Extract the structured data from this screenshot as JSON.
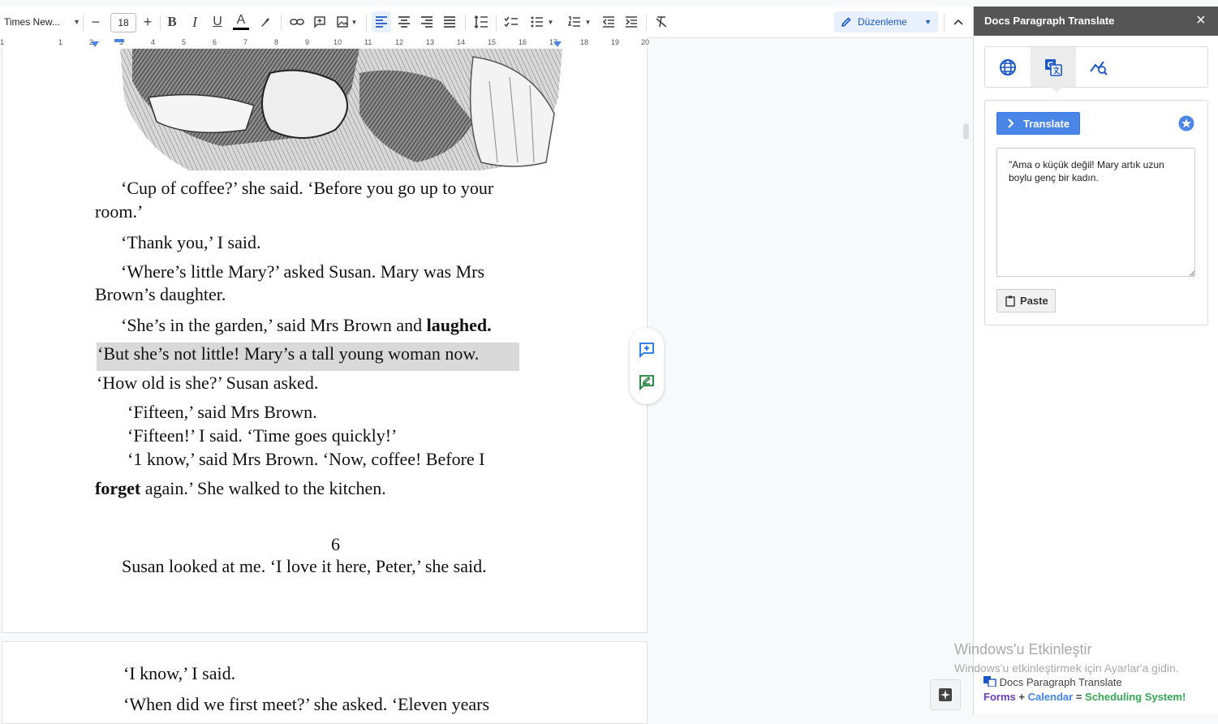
{
  "toolbar": {
    "font_name": "Times New...",
    "font_size": "18",
    "mode_label": "Düzenleme",
    "minus": "−",
    "plus": "+",
    "bold": "B",
    "italic": "I",
    "underline": "U",
    "text_color_letter": "A"
  },
  "ruler": {
    "labels": [
      "1",
      "1",
      "2",
      "3",
      "4",
      "5",
      "6",
      "7",
      "8",
      "9",
      "10",
      "11",
      "12",
      "13",
      "14",
      "15",
      "16",
      "17",
      "18",
      "19",
      "20"
    ]
  },
  "document": {
    "page1": [
      {
        "indent": "‘Cup of coffee?’ she said. ‘Before you go up to your",
        "rest": ""
      },
      "room.’",
      "‘Thank you,’ I said.",
      "‘Where’s little Mary?’ asked Susan. Mary was Mrs",
      "Brown’s daughter.",
      "‘She’s in the garden,’ said Mrs Brown and ",
      "laughed.",
      "‘But she’s not little! Mary’s a tall young woman now.",
      "‘How old is she?’ Susan asked.",
      "‘Fifteen,’ said Mrs Brown.",
      "‘Fifteen!’ I said. ‘Time goes quickly!’",
      "‘1 know,’ said Mrs Brown. ‘Now, coffee! Before I",
      "forget",
      " again.’ She walked to the kitchen.",
      "6",
      "Susan looked at me. ‘I love it here, Peter,’ she said."
    ],
    "page2": [
      "‘I know,’ I said.",
      "‘When did we first meet?’ she asked. ‘Eleven years"
    ]
  },
  "sidebar": {
    "title": "Docs Paragraph Translate",
    "close": "×",
    "tabs": [
      "globe-icon",
      "translate-icon",
      "analytics-icon"
    ],
    "translate_label": "Translate",
    "result_text": "\"Ama o küçük değil! Mary artık uzun boylu genç bir kadın.",
    "paste_label": "Paste",
    "promo": {
      "brand": "Docs Paragraph Translate",
      "forms": "Forms",
      "plus": " + ",
      "calendar": "Calendar",
      "equals": " = ",
      "system": "Scheduling System",
      "bang": "!"
    }
  },
  "watermark": {
    "title": "Windows'u Etkinleştir",
    "subtitle": "Windows'u etkinleştirmek için Ayarlar'a gidin."
  },
  "colors": {
    "accent": "#4a86e8",
    "header": "#555555",
    "mode_bg": "#e8f0fe",
    "highlight": "#d9d9d9",
    "forms": "#6a3dc4",
    "calendar": "#4285f4",
    "system": "#34a853"
  }
}
